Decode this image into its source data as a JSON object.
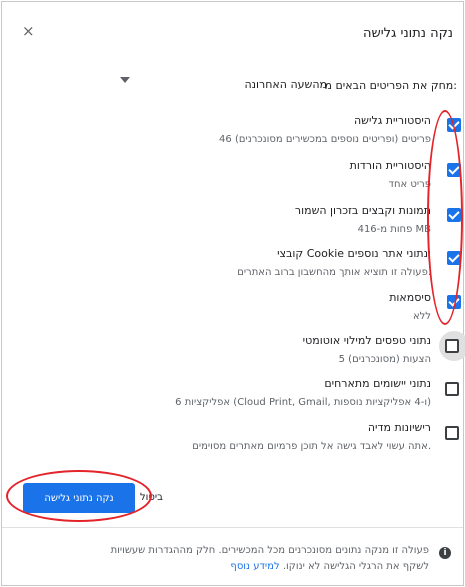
{
  "dialog": {
    "title": "נקה נתוני גלישה",
    "close_glyph": "×"
  },
  "time_range": {
    "label": "מחק את הפריטים הבאים מ:",
    "selected": "מהשעה האחרונה"
  },
  "items": [
    {
      "title": "היסטוריית גלישה",
      "subtitle": "46 פריטים (ופריטים נוספים במכשירים מסונכרנים)",
      "checked": true
    },
    {
      "title": "היסטוריית הורדות",
      "subtitle": "פריט אחד",
      "checked": true
    },
    {
      "title": "תמונות וקבצים בזכרון השמור",
      "subtitle": "פחות מ-416 MB",
      "checked": true
    },
    {
      "title": "קובצי Cookie ונתוני אתר נוספים",
      "subtitle": "פעולה זו תוציא אותך מהחשבון ברוב האתרים.",
      "checked": true
    },
    {
      "title": "סיסמאות",
      "subtitle": "ללא",
      "checked": true
    },
    {
      "title": "נתוני טפסים למילוי אוטומטי",
      "subtitle": "5 הצעות (מסונכרנים)",
      "checked": false
    },
    {
      "title": "נתוני יישומים מתארחים",
      "subtitle": "6 אפליקציות (Cloud Print, Gmail, ו-4 אפליקציות נוספות)",
      "checked": false
    },
    {
      "title": "רישיונות מדיה",
      "subtitle": "אתה עשוי לאבד גישה אל תוכן פרמיום מאתרים מסוימים.",
      "checked": false
    }
  ],
  "actions": {
    "clear_label": "נקה נתוני גלישה",
    "cancel_label": "ביטול"
  },
  "footer": {
    "line1": "פעולה זו מנקה נתונים מסונכרנים מכל המכשירים. חלק מההגדרות שעשויות",
    "line2": "לשקף את הרגלי הגלישה לא ינוקו.",
    "learn_more": "למידע נוסף",
    "info_glyph": "i"
  },
  "colors": {
    "accent": "#1a73e8",
    "annotation": "#e3242b"
  }
}
